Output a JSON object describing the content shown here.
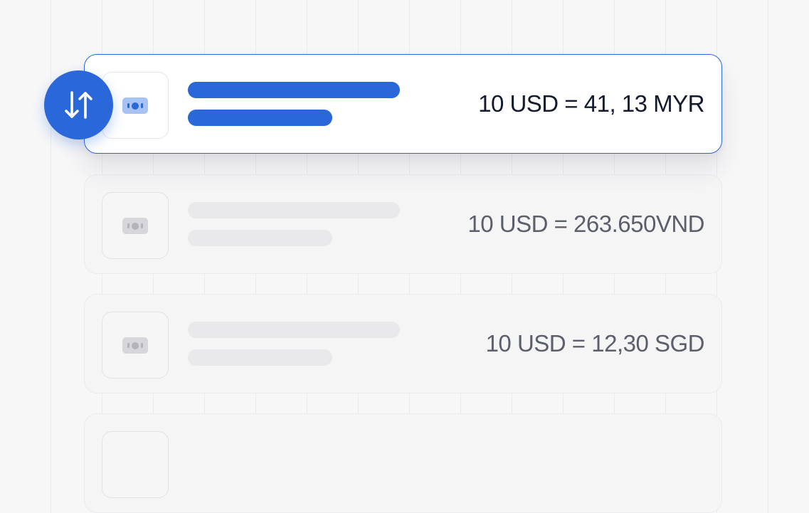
{
  "rates": [
    {
      "text": "10 USD = 41, 13 MYR",
      "state": "active"
    },
    {
      "text": "10 USD = 263.650VND",
      "state": "inactive"
    },
    {
      "text": "10 USD = 12,30 SGD",
      "state": "inactive"
    },
    {
      "text": "",
      "state": "inactive"
    }
  ],
  "icons": {
    "swap": "swap-vertical-arrows-icon",
    "currency": "banknote-icon"
  },
  "colors": {
    "accent": "#2a67d8",
    "accent_light": "#a7c3f4",
    "text_active": "#141a2e",
    "text_inactive": "#5b5f6b",
    "placeholder": "#e9e9ec",
    "background": "#f7f7f8"
  }
}
